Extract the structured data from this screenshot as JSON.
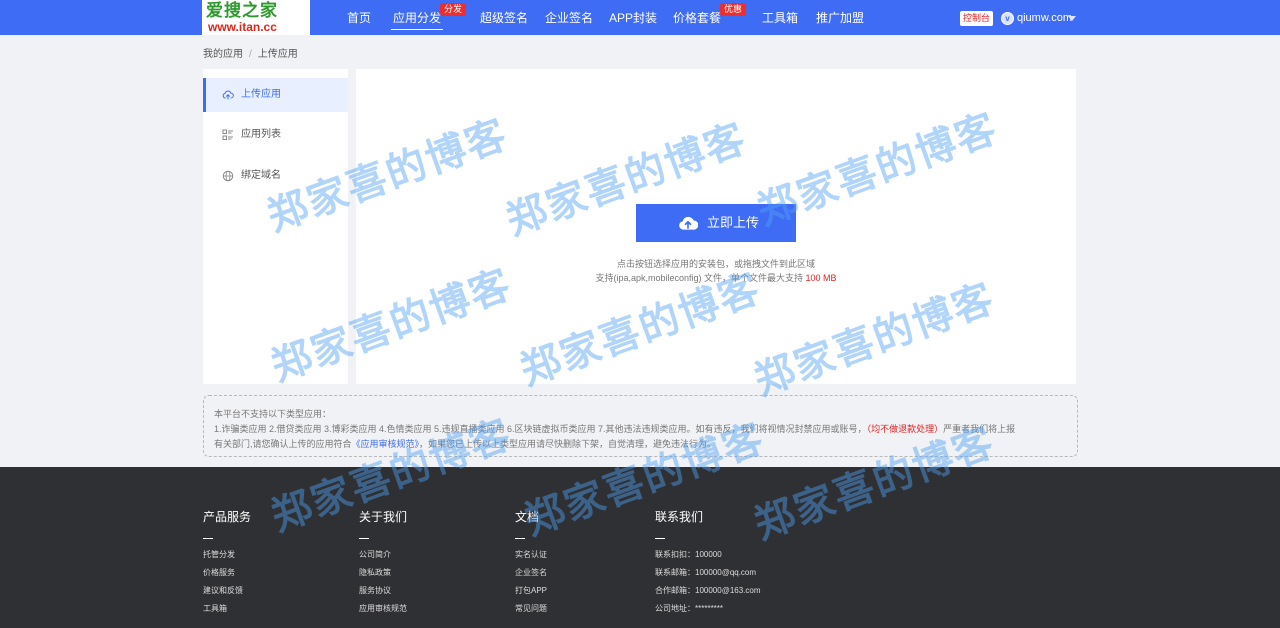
{
  "header": {
    "logo_top": "爱搜之家",
    "logo_bottom": "www.itan.cc",
    "nav": [
      {
        "label": "首页"
      },
      {
        "label": "应用分发",
        "badge": "分发"
      },
      {
        "label": "超级签名"
      },
      {
        "label": "企业签名"
      },
      {
        "label": "APP封装"
      },
      {
        "label": "价格套餐",
        "badge": "优惠"
      },
      {
        "label": "工具箱"
      },
      {
        "label": "推广加盟"
      }
    ],
    "console": "控制台",
    "avatar": "v",
    "username": "qiumw.com"
  },
  "breadcrumb": {
    "root": "我的应用",
    "sep": "/",
    "current": "上传应用"
  },
  "sidebar": {
    "items": [
      {
        "label": "上传应用",
        "icon": "cloud-upload-icon"
      },
      {
        "label": "应用列表",
        "icon": "list-icon"
      },
      {
        "label": "绑定域名",
        "icon": "globe-icon"
      }
    ]
  },
  "upload": {
    "button": "立即上传",
    "hint1": "点击按钮选择应用的安装包，或拖拽文件到此区域",
    "hint2_prefix": "支持(ipa,apk,mobileconfig) 文件，单个文件最大支持 ",
    "hint2_limit": "100 MB"
  },
  "notice": {
    "line1": "本平台不支持以下类型应用：",
    "line2_text": "1.诈骗类应用 2.借贷类应用 3.博彩类应用 4.色情类应用 5.违规直播类应用 6.区块链虚拟币类应用 7.其他违法违规类应用。如有违反，我们将视情况封禁应用或账号，",
    "line2_red": "（均不做退款处理）",
    "line2_tail": "严重者我们将上报",
    "line3_prefix": "有关部门,请您确认上传的应用符合",
    "line3_link": "《应用审核规范》",
    "line3_suffix": "，如果您已上传以上类型应用请尽快删除下架，自觉清理，避免违法行为。"
  },
  "footer": {
    "columns": [
      {
        "title": "产品服务",
        "links": [
          "托管分发",
          "价格服务",
          "建议和反馈",
          "工具箱"
        ]
      },
      {
        "title": "关于我们",
        "links": [
          "公司简介",
          "隐私政策",
          "服务协议",
          "应用审核规范"
        ]
      },
      {
        "title": "文档",
        "links": [
          "实名认证",
          "企业签名",
          "打包APP",
          "常见问题"
        ]
      },
      {
        "title": "联系我们",
        "links": [
          "联系扣扣：100000",
          "联系邮箱：100000@qq.com",
          "合作邮箱：100000@163.com",
          "公司地址：*********"
        ]
      }
    ]
  },
  "watermark": "郑家喜的博客",
  "colors": {
    "primary": "#3f6cf5",
    "danger": "#e02424",
    "footer_bg": "#2f3033",
    "page_bg": "#f0f2f5"
  }
}
